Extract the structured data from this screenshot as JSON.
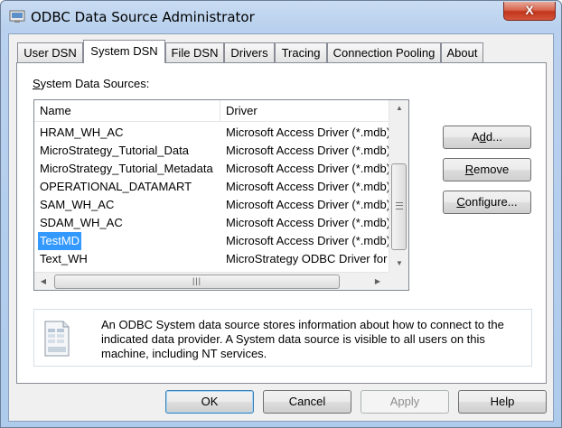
{
  "window": {
    "title": "ODBC Data Source Administrator",
    "close_glyph": "X",
    "accent_color": "#3399ff"
  },
  "tabs": [
    {
      "label": "User DSN",
      "active": false
    },
    {
      "label": "System DSN",
      "active": true
    },
    {
      "label": "File DSN",
      "active": false
    },
    {
      "label": "Drivers",
      "active": false
    },
    {
      "label": "Tracing",
      "active": false
    },
    {
      "label": "Connection Pooling",
      "active": false
    },
    {
      "label": "About",
      "active": false
    }
  ],
  "system_dsn": {
    "group_label_prefix": "S",
    "group_label_rest": "ystem Data Sources:",
    "columns": {
      "name": "Name",
      "driver": "Driver"
    },
    "rows": [
      {
        "name": "HRAM_WH_AC",
        "driver": "Microsoft Access Driver (*.mdb)"
      },
      {
        "name": "MicroStrategy_Tutorial_Data",
        "driver": "Microsoft Access Driver (*.mdb)"
      },
      {
        "name": "MicroStrategy_Tutorial_Metadata",
        "driver": "Microsoft Access Driver (*.mdb)"
      },
      {
        "name": "OPERATIONAL_DATAMART",
        "driver": "Microsoft Access Driver (*.mdb)"
      },
      {
        "name": "SAM_WH_AC",
        "driver": "Microsoft Access Driver (*.mdb)"
      },
      {
        "name": "SDAM_WH_AC",
        "driver": "Microsoft Access Driver (*.mdb)"
      },
      {
        "name": "TestMD",
        "driver": "Microsoft Access Driver (*.mdb)",
        "selected": true
      },
      {
        "name": "Text_WH",
        "driver": "MicroStrategy ODBC Driver for Text"
      }
    ],
    "scroll_up_glyph": "▲",
    "scroll_down_glyph": "▼",
    "scroll_left_glyph": "◀",
    "scroll_right_glyph": "▶",
    "hthumb_grip": "|||",
    "buttons": {
      "add_prefix": "A",
      "add_ul": "d",
      "add_rest": "d...",
      "remove_ul": "R",
      "remove_rest": "emove",
      "configure_ul": "C",
      "configure_rest": "onfigure..."
    },
    "info_text": "An ODBC System data source stores information about how to connect to the indicated data provider.   A System data source is visible to all users on this machine, including NT services."
  },
  "footer": {
    "ok_label": "OK",
    "cancel_label": "Cancel",
    "apply_label": "Apply",
    "help_label": "Help"
  }
}
